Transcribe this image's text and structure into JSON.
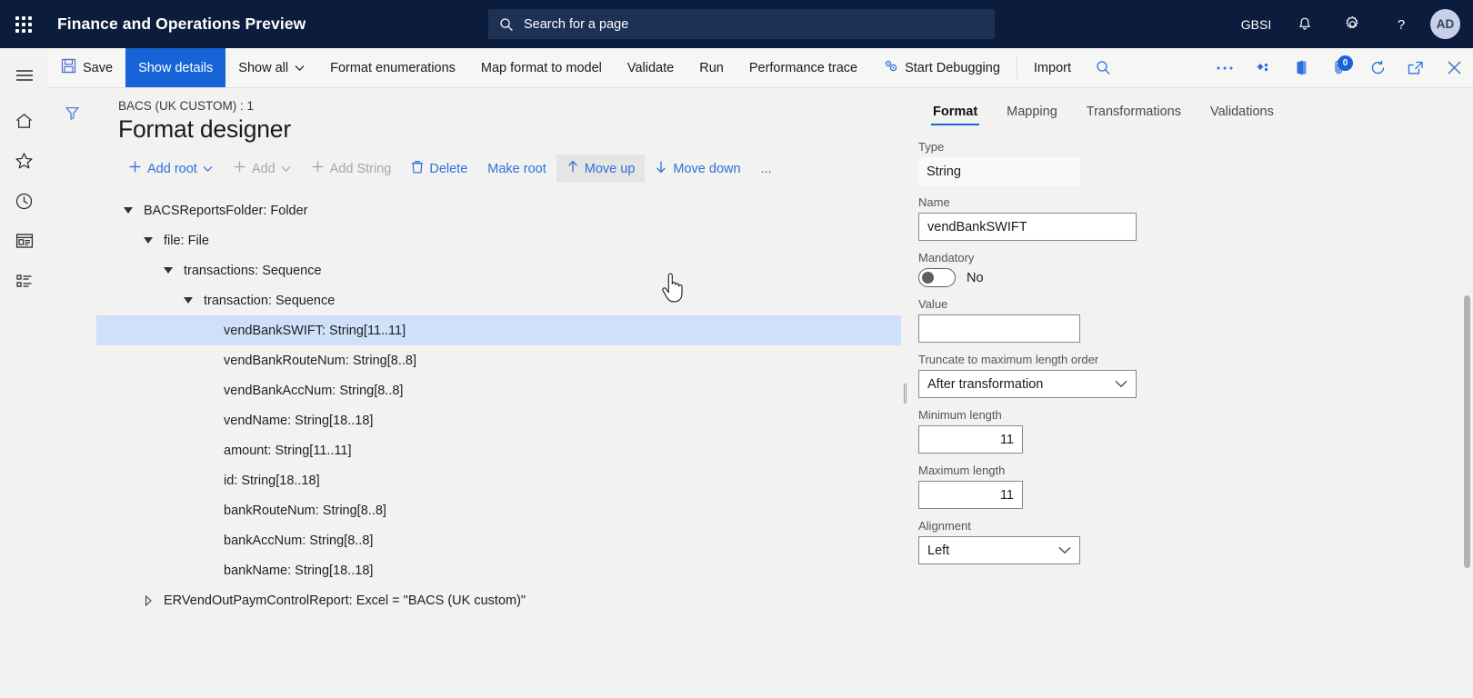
{
  "topnav": {
    "waffle_name": "app-launcher",
    "app_title": "Finance and Operations Preview",
    "search_placeholder": "Search for a page",
    "search_value": "",
    "company": "GBSI",
    "notifications_label": "notifications",
    "settings_label": "settings",
    "help_label": "help",
    "avatar_initials": "AD",
    "bg_color": "#0b1c3d",
    "search_bg": "#1d3156"
  },
  "rail": {
    "items": [
      {
        "name": "nav-menu",
        "icon": "hamburger-icon"
      },
      {
        "name": "nav-home",
        "icon": "home-icon"
      },
      {
        "name": "nav-favorites",
        "icon": "star-icon"
      },
      {
        "name": "nav-recent",
        "icon": "clock-icon"
      },
      {
        "name": "nav-workspaces",
        "icon": "workspace-icon"
      },
      {
        "name": "nav-modules",
        "icon": "list-icon"
      }
    ]
  },
  "toolbar": {
    "save_label": "Save",
    "show_details_label": "Show details",
    "show_all_label": "Show all",
    "format_enumerations_label": "Format enumerations",
    "map_format_label": "Map format to model",
    "validate_label": "Validate",
    "run_label": "Run",
    "performance_trace_label": "Performance trace",
    "start_debugging_label": "Start Debugging",
    "import_label": "Import",
    "overflow_label": "...",
    "accent": "#1664d8",
    "attachments_badge": "0"
  },
  "page": {
    "breadcrumb": "BACS (UK CUSTOM) : 1",
    "title": "Format designer"
  },
  "commands": [
    {
      "label": "Add root",
      "icon": "plus-icon",
      "disabled": false,
      "caret": true,
      "hovered": false,
      "name": "add-root-button"
    },
    {
      "label": "Add",
      "icon": "plus-icon",
      "disabled": true,
      "caret": true,
      "hovered": false,
      "name": "add-button"
    },
    {
      "label": "Add String",
      "icon": "plus-icon",
      "disabled": true,
      "caret": false,
      "hovered": false,
      "name": "add-string-button"
    },
    {
      "label": "Delete",
      "icon": "trash-icon",
      "disabled": false,
      "caret": false,
      "hovered": false,
      "name": "delete-button"
    },
    {
      "label": "Make root",
      "icon": "",
      "disabled": false,
      "caret": false,
      "hovered": false,
      "name": "make-root-button"
    },
    {
      "label": "Move up",
      "icon": "arrow-up-icon",
      "disabled": false,
      "caret": false,
      "hovered": true,
      "name": "move-up-button"
    },
    {
      "label": "Move down",
      "icon": "arrow-down-icon",
      "disabled": false,
      "caret": false,
      "hovered": false,
      "name": "move-down-button"
    },
    {
      "label": "...",
      "icon": "",
      "disabled": false,
      "caret": false,
      "hovered": false,
      "name": "command-overflow-button"
    }
  ],
  "tree": [
    {
      "label": "BACSReportsFolder: Folder",
      "depth": 0,
      "twisty": "expanded",
      "selected": false
    },
    {
      "label": "file: File",
      "depth": 1,
      "twisty": "expanded",
      "selected": false
    },
    {
      "label": "transactions: Sequence",
      "depth": 2,
      "twisty": "expanded",
      "selected": false
    },
    {
      "label": "transaction: Sequence",
      "depth": 3,
      "twisty": "expanded",
      "selected": false
    },
    {
      "label": "vendBankSWIFT: String[11..11]",
      "depth": 4,
      "twisty": "none",
      "selected": true
    },
    {
      "label": "vendBankRouteNum: String[8..8]",
      "depth": 4,
      "twisty": "none",
      "selected": false
    },
    {
      "label": "vendBankAccNum: String[8..8]",
      "depth": 4,
      "twisty": "none",
      "selected": false
    },
    {
      "label": "vendName: String[18..18]",
      "depth": 4,
      "twisty": "none",
      "selected": false
    },
    {
      "label": "amount: String[11..11]",
      "depth": 4,
      "twisty": "none",
      "selected": false
    },
    {
      "label": "id: String[18..18]",
      "depth": 4,
      "twisty": "none",
      "selected": false
    },
    {
      "label": "bankRouteNum: String[8..8]",
      "depth": 4,
      "twisty": "none",
      "selected": false
    },
    {
      "label": "bankAccNum: String[8..8]",
      "depth": 4,
      "twisty": "none",
      "selected": false
    },
    {
      "label": "bankName: String[18..18]",
      "depth": 4,
      "twisty": "none",
      "selected": false
    },
    {
      "label": "ERVendOutPaymControlReport: Excel = \"BACS (UK custom)\"",
      "depth": 1,
      "twisty": "collapsed",
      "selected": false
    }
  ],
  "panel": {
    "tabs": [
      {
        "label": "Format",
        "active": true
      },
      {
        "label": "Mapping",
        "active": false
      },
      {
        "label": "Transformations",
        "active": false
      },
      {
        "label": "Validations",
        "active": false
      }
    ],
    "fields": {
      "type_label": "Type",
      "type_value": "String",
      "name_label": "Name",
      "name_value": "vendBankSWIFT",
      "mandatory_label": "Mandatory",
      "mandatory_value": "No",
      "value_label": "Value",
      "value_value": "",
      "truncate_label": "Truncate to maximum length order",
      "truncate_value": "After transformation",
      "min_length_label": "Minimum length",
      "min_length_value": "11",
      "max_length_label": "Maximum length",
      "max_length_value": "11",
      "alignment_label": "Alignment",
      "alignment_value": "Left"
    }
  }
}
